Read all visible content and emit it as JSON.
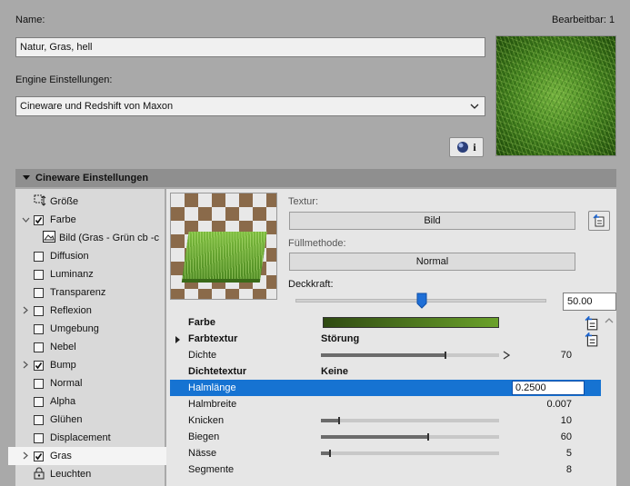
{
  "header": {
    "name_label": "Name:",
    "editable_label": "Bearbeitbar: 1",
    "name_value": "Natur, Gras, hell",
    "engine_label": "Engine Einstellungen:",
    "engine_value": "Cineware und Redshift von Maxon"
  },
  "section": {
    "title": "Cineware Einstellungen"
  },
  "tree": [
    {
      "label": "Größe",
      "type": "size-icon",
      "checked": false,
      "expander": false,
      "indent": 0
    },
    {
      "label": "Farbe",
      "type": "checkbox",
      "checked": true,
      "expander": "down",
      "indent": 0
    },
    {
      "label": "Bild (Gras - Grün cb -c",
      "type": "image-icon",
      "checked": false,
      "expander": false,
      "indent": 1
    },
    {
      "label": "Diffusion",
      "type": "checkbox",
      "checked": false,
      "expander": false,
      "indent": 0
    },
    {
      "label": "Luminanz",
      "type": "checkbox",
      "checked": false,
      "expander": false,
      "indent": 0
    },
    {
      "label": "Transparenz",
      "type": "checkbox",
      "checked": false,
      "expander": false,
      "indent": 0
    },
    {
      "label": "Reflexion",
      "type": "checkbox",
      "checked": false,
      "expander": "right",
      "indent": 0
    },
    {
      "label": "Umgebung",
      "type": "checkbox",
      "checked": false,
      "expander": false,
      "indent": 0
    },
    {
      "label": "Nebel",
      "type": "checkbox",
      "checked": false,
      "expander": false,
      "indent": 0
    },
    {
      "label": "Bump",
      "type": "checkbox",
      "checked": true,
      "expander": "right",
      "indent": 0
    },
    {
      "label": "Normal",
      "type": "checkbox",
      "checked": false,
      "expander": false,
      "indent": 0
    },
    {
      "label": "Alpha",
      "type": "checkbox",
      "checked": false,
      "expander": false,
      "indent": 0
    },
    {
      "label": "Glühen",
      "type": "checkbox",
      "checked": false,
      "expander": false,
      "indent": 0
    },
    {
      "label": "Displacement",
      "type": "checkbox",
      "checked": false,
      "expander": false,
      "indent": 0
    },
    {
      "label": "Gras",
      "type": "checkbox",
      "checked": true,
      "expander": "right",
      "indent": 0,
      "highlighted": true
    },
    {
      "label": "Leuchten",
      "type": "lock-icon",
      "checked": false,
      "expander": false,
      "indent": 0
    }
  ],
  "texture": {
    "texture_label": "Textur:",
    "texture_button": "Bild",
    "fill_label": "Füllmethode:",
    "fill_button": "Normal",
    "opacity_label": "Deckkraft:",
    "opacity_value": "50.00",
    "opacity_fraction": 0.5
  },
  "properties": [
    {
      "name": "Farbe",
      "bold": true,
      "kind": "color",
      "value": "",
      "color_start": "#2f4a12",
      "color_end": "#6aa12a"
    },
    {
      "name": "Farbtextur",
      "bold": true,
      "kind": "text",
      "value": "Störung",
      "expander": true
    },
    {
      "name": "Dichte",
      "bold": false,
      "kind": "slider",
      "value": "70",
      "fraction": 0.7
    },
    {
      "name": "Dichtetextur",
      "bold": true,
      "kind": "text",
      "value": "Keine"
    },
    {
      "name": "Halmlänge",
      "bold": false,
      "kind": "input",
      "value": "0.2500",
      "selected": true
    },
    {
      "name": "Halmbreite",
      "bold": false,
      "kind": "plain",
      "value": "0.007"
    },
    {
      "name": "Knicken",
      "bold": false,
      "kind": "slider",
      "value": "10",
      "fraction": 0.1
    },
    {
      "name": "Biegen",
      "bold": false,
      "kind": "slider",
      "value": "60",
      "fraction": 0.6
    },
    {
      "name": "Nässe",
      "bold": false,
      "kind": "slider",
      "value": "5",
      "fraction": 0.05
    },
    {
      "name": "Segmente",
      "bold": false,
      "kind": "plain",
      "value": "8"
    }
  ]
}
